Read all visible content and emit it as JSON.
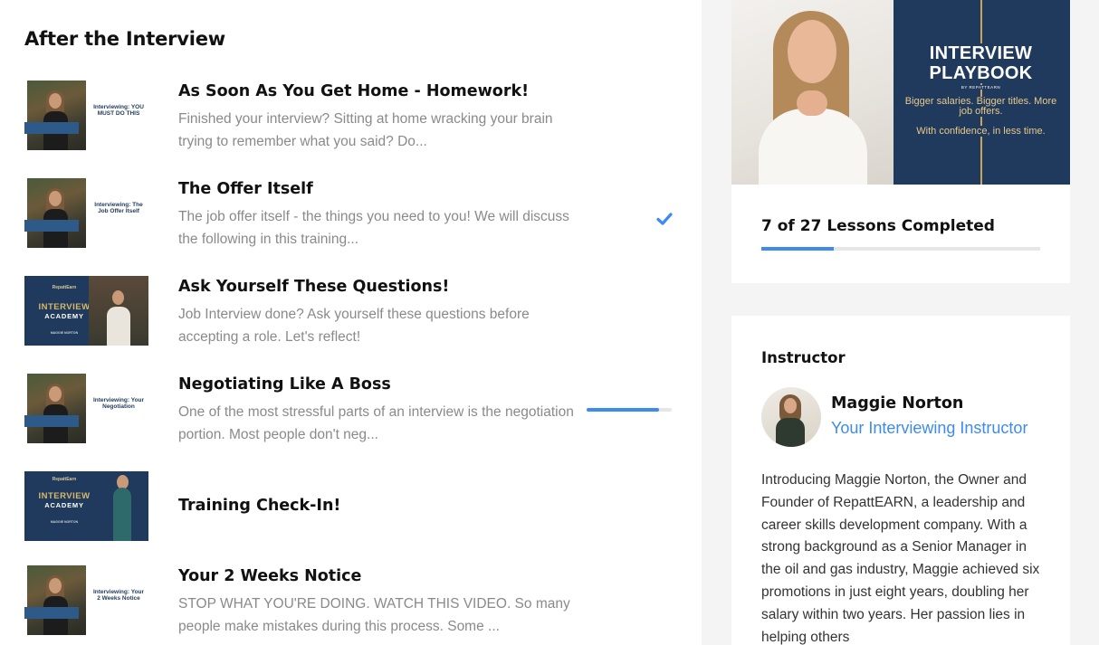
{
  "section": {
    "title": "After the Interview"
  },
  "lessons": [
    {
      "title": "As Soon As You Get Home - Homework!",
      "description": "Finished your interview? Sitting at home wracking your brain trying to remember what you said? Do...",
      "thumb_caption": "Interviewing: YOU MUST DO THIS",
      "status": "none"
    },
    {
      "title": "The Offer Itself",
      "description": "The job offer itself - the things you need to you! We will discuss the following in this training...",
      "thumb_caption": "Interviewing: The Job Offer Itself",
      "status": "completed",
      "status_icon": "checkmark-icon"
    },
    {
      "title": "Ask Yourself These Questions!",
      "description": "Job Interview done? Ask yourself these questions before accepting a role. Let's reflect!",
      "thumb_logo": "RepattEarn",
      "thumb_line1": "INTERVIEW",
      "thumb_line2": "ACADEMY",
      "thumb_line3": "MAGGIE NORTON",
      "status": "none"
    },
    {
      "title": "Negotiating Like A Boss",
      "description": "One of the most stressful parts of an interview is the negotiation portion. Most people don't neg...",
      "thumb_caption": "Interviewing: Your Negotiation",
      "status": "in-progress",
      "progress": 0.85
    },
    {
      "title": "Training Check-In!",
      "description": "",
      "thumb_logo": "RepattEarn",
      "thumb_line1": "INTERVIEW",
      "thumb_line2": "ACADEMY",
      "thumb_line3": "MAGGIE NORTON",
      "status": "none"
    },
    {
      "title": "Your 2 Weeks Notice",
      "description": "STOP WHAT YOU'RE DOING. WATCH THIS VIDEO. So many people make mistakes during this process. Some ...",
      "thumb_caption": "Interviewing: Your 2 Weeks Notice",
      "status": "none"
    }
  ],
  "course": {
    "cover_title": "INTERVIEW PLAYBOOK",
    "cover_by": "BY REPATTEARN",
    "cover_tagline": "Bigger salaries. Bigger titles. More job offers.",
    "cover_tagline2": "With confidence, in less time.",
    "completed_label": "7 of 27 Lessons Completed",
    "completed": 7,
    "total": 27
  },
  "instructor": {
    "heading": "Instructor",
    "name": "Maggie Norton",
    "role": "Your Interviewing Instructor",
    "bio": "Introducing Maggie Norton, the Owner and Founder of RepattEARN, a leadership and career skills development company. With a strong background as a Senior Manager in the oil and gas industry, Maggie achieved six promotions in just eight years, doubling her salary within two years. Her passion lies in helping others"
  },
  "colors": {
    "accent": "#3d8bf0",
    "navy": "#1f3a5c",
    "gold": "#c9a45a"
  }
}
